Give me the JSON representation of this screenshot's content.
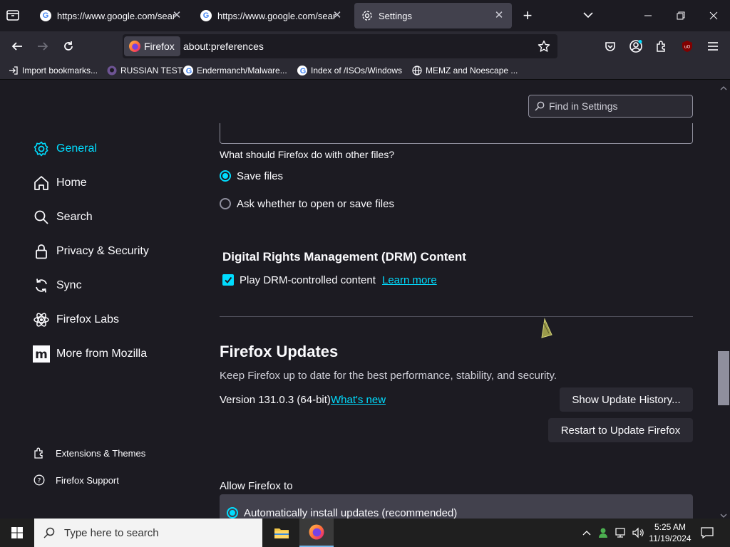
{
  "tabs": [
    {
      "title": "https://www.google.com/search",
      "icon": "google-icon",
      "active": false
    },
    {
      "title": "https://www.google.com/search",
      "icon": "google-icon",
      "active": false
    },
    {
      "title": "Settings",
      "icon": "gear-icon",
      "active": true
    }
  ],
  "nav": {
    "identity_label": "Firefox",
    "url": "about:preferences"
  },
  "bookmarks": [
    {
      "label": "Import bookmarks...",
      "icon": "import-icon"
    },
    {
      "label": "RUSSIAN TEST",
      "icon": "github-icon"
    },
    {
      "label": "Endermanch/Malware...",
      "icon": "google-icon"
    },
    {
      "label": "Index of /ISOs/Windows",
      "icon": "google-icon"
    },
    {
      "label": "MEMZ and Noescape ...",
      "icon": "globe-icon"
    }
  ],
  "find": {
    "placeholder": "Find in Settings"
  },
  "sidebar": {
    "categories": [
      {
        "label": "General",
        "icon": "gear-icon",
        "active": true
      },
      {
        "label": "Home",
        "icon": "home-icon"
      },
      {
        "label": "Search",
        "icon": "search-icon"
      },
      {
        "label": "Privacy & Security",
        "icon": "lock-icon"
      },
      {
        "label": "Sync",
        "icon": "sync-icon"
      },
      {
        "label": "Firefox Labs",
        "icon": "flask-icon"
      },
      {
        "label": "More from Mozilla",
        "icon": "mozilla-icon"
      }
    ],
    "footer": [
      {
        "label": "Extensions & Themes",
        "icon": "puzzle-icon"
      },
      {
        "label": "Firefox Support",
        "icon": "help-icon"
      }
    ]
  },
  "files": {
    "question": "What should Firefox do with other files?",
    "options": [
      {
        "label": "Save files",
        "selected": true
      },
      {
        "label": "Ask whether to open or save files",
        "selected": false
      }
    ]
  },
  "drm": {
    "heading": "Digital Rights Management (DRM) Content",
    "checkbox_label": "Play DRM-controlled content",
    "checked": true,
    "learn_more": "Learn more"
  },
  "updates": {
    "heading": "Firefox Updates",
    "description": "Keep Firefox up to date for the best performance, stability, and security.",
    "version": "Version 131.0.3 (64-bit)",
    "whats_new": "What's new",
    "history_button": "Show Update History...",
    "restart_button": "Restart to Update Firefox",
    "allow_label": "Allow Firefox to",
    "auto_option": "Automatically install updates (recommended)"
  },
  "taskbar": {
    "search_placeholder": "Type here to search",
    "time": "5:25 AM",
    "date": "11/19/2024"
  },
  "colors": {
    "accent": "#00ddff",
    "background": "#1c1b22",
    "toolbar": "#2b2a33"
  }
}
